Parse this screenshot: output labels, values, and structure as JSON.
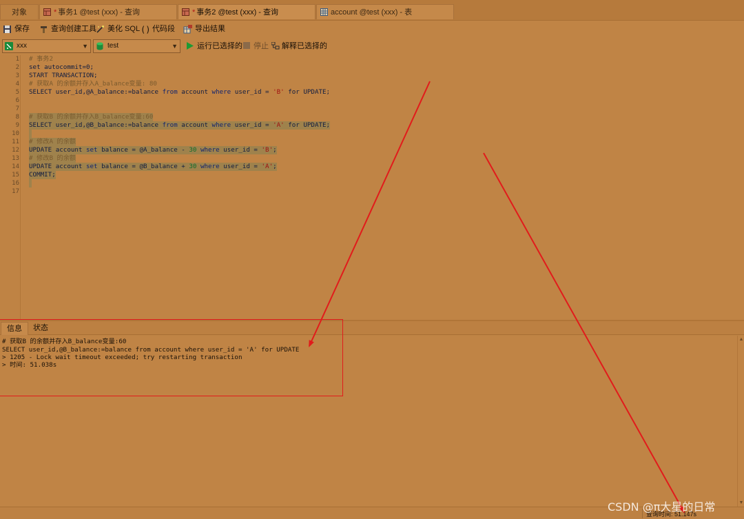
{
  "tabs": [
    {
      "label": "对象"
    },
    {
      "label": "事务1 @test (xxx) - 查询",
      "modified": "*"
    },
    {
      "label": "事务2 @test (xxx) - 查询",
      "modified": "*"
    },
    {
      "label": "account @test (xxx) - 表"
    }
  ],
  "toolbar": {
    "save": "保存",
    "query_builder": "查询创建工具",
    "beautify": "美化 SQL",
    "code_snippet": "代码段",
    "export": "导出结果"
  },
  "connbar": {
    "connection": "xxx",
    "database": "test",
    "run_selected": "运行已选择的",
    "stop": "停止",
    "explain": "解释已选择的"
  },
  "editor": {
    "line_numbers": [
      "1",
      "2",
      "3",
      "4",
      "5",
      "6",
      "7",
      "8",
      "9",
      "10",
      "11",
      "12",
      "13",
      "14",
      "15",
      "16",
      "17"
    ],
    "lines": {
      "l1": "# 事务2",
      "l2": "set autocommit=0;",
      "l3": "START TRANSACTION;",
      "l4": "# 获取A 的余额并存入A_balance变量: 80",
      "l5a": "SELECT user_id,@A_balance:=balance ",
      "l5b": "from",
      "l5c": " account ",
      "l5d": "where",
      "l5e": " user_id = ",
      "l5f": "'B'",
      "l5g": " for UPDATE;",
      "l8": "# 获取B 的余额并存入B_balance变量:60",
      "l9a": "SELECT user_id,@B_balance:=balance ",
      "l9b": "from",
      "l9c": " account ",
      "l9d": "where",
      "l9e": " user_id = ",
      "l9f": "'A'",
      "l9g": " for UPDATE;",
      "l11": "# 修改A 的余额",
      "l12a": "UPDATE account ",
      "l12b": "set",
      "l12c": " balance = @A_balance - ",
      "l12d": "30",
      "l12e": " where",
      "l12f": " user_id = ",
      "l12g": "'B'",
      "l12h": ";",
      "l13": "# 修改B 的余额",
      "l14a": "UPDATE account ",
      "l14b": "set",
      "l14c": " balance = @B_balance + ",
      "l14d": "30",
      "l14e": " where",
      "l14f": " user_id = ",
      "l14g": "'A'",
      "l14h": ";",
      "l15": "COMMIT;"
    }
  },
  "bottom_tabs": {
    "info": "信息",
    "status": "状态"
  },
  "messages": [
    "# 获取B 的余额并存入B_balance变量:60",
    "SELECT user_id,@B_balance:=balance from account where user_id = 'A' for UPDATE",
    "> 1205 - Lock wait timeout exceeded; try restarting transaction",
    "> 时间: 51.038s"
  ],
  "statusbar": {
    "query_time": "查询时间: 51.147s"
  },
  "watermark": "CSDN @π大星的日常",
  "colors": {
    "annotation": "#e11b1b",
    "background": "#be8244"
  }
}
